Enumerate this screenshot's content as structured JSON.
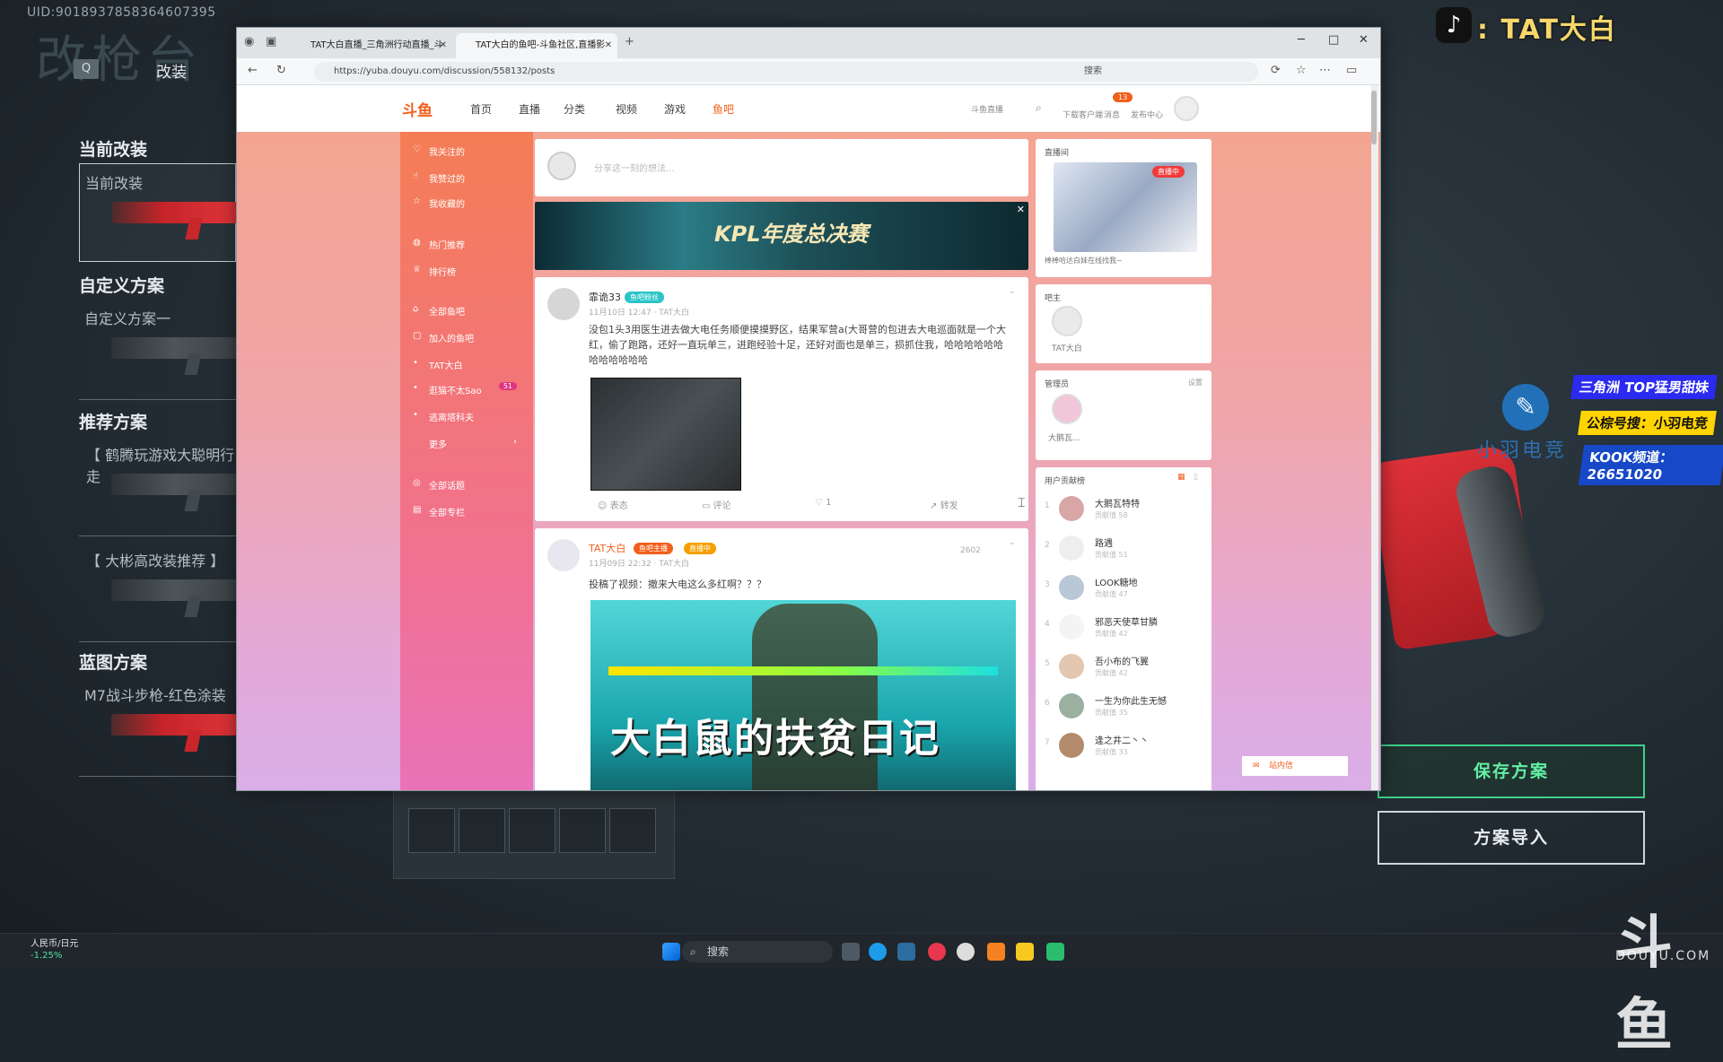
{
  "game": {
    "uid": "UID:9018937858364607395",
    "bg_title": "改枪台",
    "mode_key": "Q",
    "mode_label": "改装",
    "sections": {
      "current": "当前改装",
      "custom": "自定义方案",
      "recommended": "推荐方案",
      "blueprint": "蓝图方案"
    },
    "plans": {
      "current": "当前改装",
      "custom1": "自定义方案一",
      "rec1": "【 鹤腾玩游戏大聪明行走",
      "rec2": "【 大彬高改装推荐 】",
      "blue1": "M7战斗步枪-红色涂装"
    },
    "buttons": {
      "save": "保存方案",
      "import": "方案导入"
    }
  },
  "overlay": {
    "streamer": ": TAT大白",
    "promo1": "三角洲 TOP猛男甜妹",
    "promo2": "公棕号搜：小羽电竞",
    "promo3": "KOOK频道：26651020",
    "feather_text": "小羽电竞",
    "watermark": "斗鱼",
    "watermark_en": "DOUYU.COM"
  },
  "taskbar": {
    "fx_label": "人民币/日元",
    "fx_change": "-1.25%",
    "search": "搜索"
  },
  "browser": {
    "tabs": [
      {
        "label": "TAT大白直播_三角洲行动直播_斗"
      },
      {
        "label": "TAT大白的鱼吧-斗鱼社区,直播影"
      }
    ],
    "url": "https://yuba.douyu.com/discussion/558132/posts",
    "search_placeholder": "搜索"
  },
  "site": {
    "logo": "斗鱼",
    "nav": [
      "首页",
      "直播",
      "分类",
      "视频",
      "游戏",
      "鱼吧"
    ],
    "nav_right": [
      "斗鱼直播",
      "下载客户端",
      "消息",
      "发布中心"
    ],
    "notif_count": "13",
    "sidebar": [
      {
        "icon": "heart-icon",
        "label": "我关注的"
      },
      {
        "icon": "thumb-icon",
        "label": "我赞过的"
      },
      {
        "icon": "star-icon",
        "label": "我收藏的"
      },
      {
        "icon": "fire-icon",
        "label": "热门推荐"
      },
      {
        "icon": "trophy-icon",
        "label": "排行榜"
      },
      {
        "icon": "grid-icon",
        "label": "全部鱼吧"
      },
      {
        "icon": "join-icon",
        "label": "加入的鱼吧"
      },
      {
        "icon": "dot-icon",
        "label": "TAT大白"
      },
      {
        "icon": "dot-icon",
        "label": "逛猫不太Sao",
        "badge": "51"
      },
      {
        "icon": "dot-icon",
        "label": "逃离塔科夫"
      },
      {
        "icon": "",
        "label": "更多"
      },
      {
        "icon": "topic-icon",
        "label": "全部话题"
      },
      {
        "icon": "column-icon",
        "label": "全部专栏"
      }
    ],
    "compose_placeholder": "分享这一刻的想法...",
    "banner_text": "KPL年度总决赛",
    "posts": [
      {
        "user": "霏诡33",
        "tag": "鱼吧粉丝",
        "meta": "11月10日 12:47 · TAT大白",
        "text": "没包1头3用医生进去做大电任务顺便摸摸野区，结果军营a(大哥营的包进去大电巡面就是一个大红，偷了跑路，还好一直玩单三，进跑经验十足，还好对面也是单三，损抓住我，哈哈哈哈哈哈哈哈哈哈哈哈",
        "actions": [
          "表态",
          "评论",
          "1",
          "转发"
        ]
      },
      {
        "user": "TAT大白",
        "tag1": "鱼吧主播",
        "tag2": "直播中",
        "meta": "11月09日 22:32 · TAT大白",
        "views": "2602",
        "text": "投稿了视频：撤来大电这么多红啊？？？",
        "video_title": "大白鼠的扶贫日记"
      }
    ],
    "right": {
      "live_title": "直播间",
      "live_tag": "直播中",
      "live_caption": "棒棒哈达白妹在线找我~",
      "owner_title": "吧主",
      "owner_name": "TAT大白",
      "admin_title": "管理员",
      "admin_setting": "设置",
      "admin_name": "大鹅瓦...",
      "rank_title": "用户贡献榜",
      "ranks": [
        {
          "name": "大鹅瓦特特",
          "val": "贡献值 58"
        },
        {
          "name": "路遇",
          "val": "贡献值 51"
        },
        {
          "name": "LOOK糖地",
          "val": "贡献值 47"
        },
        {
          "name": "邪恶天使草甘膦",
          "val": "贡献值 42"
        },
        {
          "name": "吾小布的飞翼",
          "val": "贡献值 42"
        },
        {
          "name": "一生为你此生无憾",
          "val": "贡献值 35"
        },
        {
          "name": "逢之井二丶丶",
          "val": "贡献值 33"
        }
      ],
      "message": "站内信"
    }
  }
}
